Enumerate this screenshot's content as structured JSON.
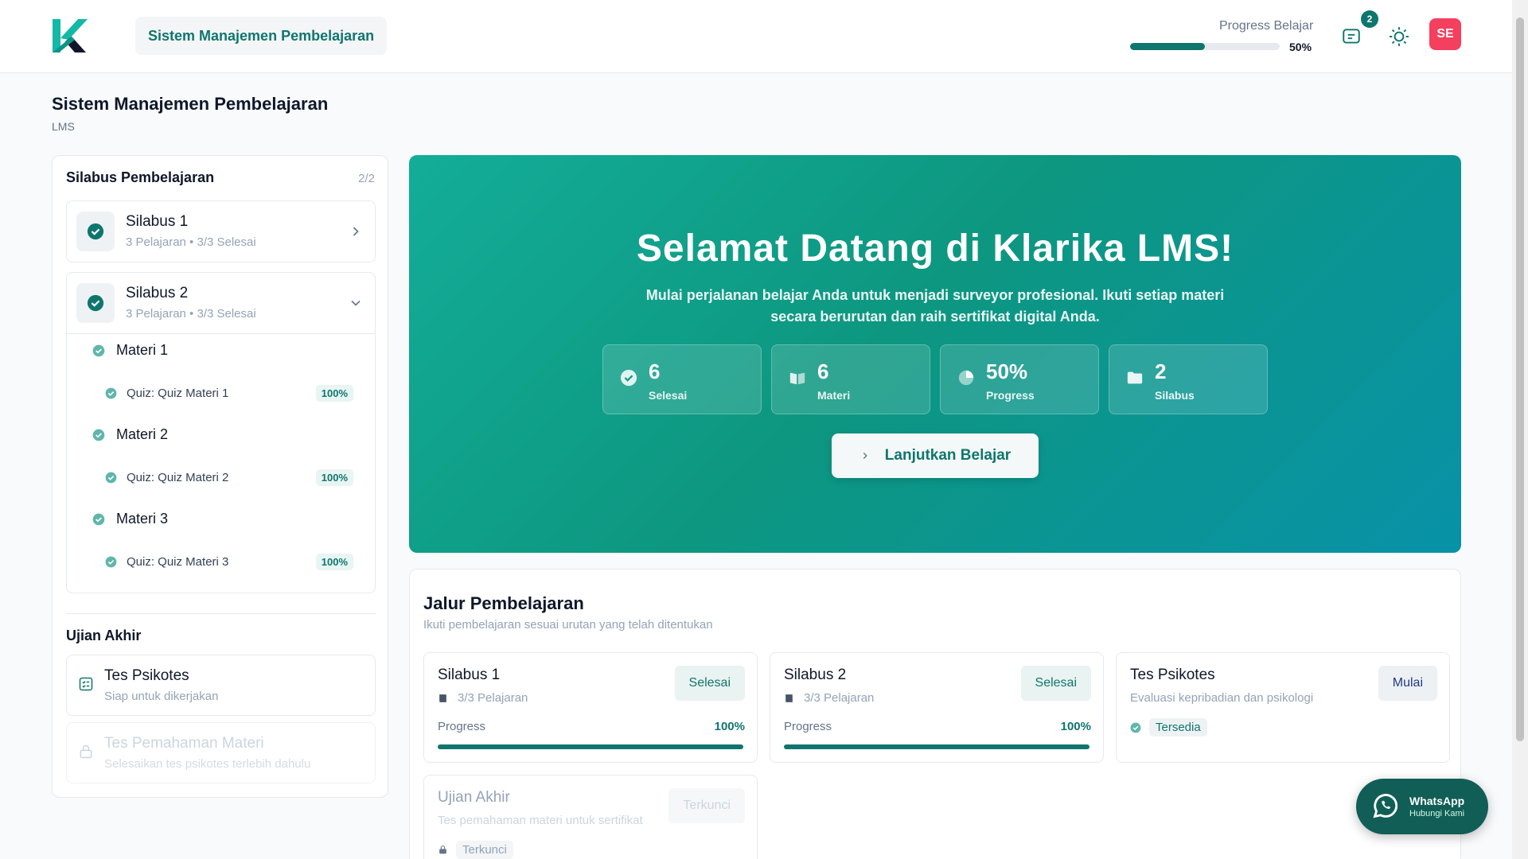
{
  "header": {
    "app_tab": "Sistem Manajemen Pembelajaran",
    "progress_label": "Progress Belajar",
    "progress_value": 50,
    "progress_text": "50%",
    "notif_count": "2",
    "avatar_initials": "SE"
  },
  "page": {
    "title": "Sistem Manajemen Pembelajaran",
    "subtitle": "LMS"
  },
  "sidebar": {
    "title": "Silabus Pembelajaran",
    "count": "2/2",
    "syllabi": [
      {
        "name": "Silabus 1",
        "meta": "3 Pelajaran • 3/3 Selesai"
      },
      {
        "name": "Silabus 2",
        "meta": "3 Pelajaran • 3/3 Selesai"
      }
    ],
    "materials": [
      {
        "name": "Materi 1",
        "quiz": "Quiz: Quiz Materi 1",
        "score": "100%"
      },
      {
        "name": "Materi 2",
        "quiz": "Quiz: Quiz Materi 2",
        "score": "100%"
      },
      {
        "name": "Materi 3",
        "quiz": "Quiz: Quiz Materi 3",
        "score": "100%"
      }
    ],
    "final_title": "Ujian Akhir",
    "exams": [
      {
        "name": "Tes Psikotes",
        "desc": "Siap untuk dikerjakan"
      },
      {
        "name": "Tes Pemahaman Materi",
        "desc": "Selesaikan tes psikotes terlebih dahulu"
      }
    ]
  },
  "hero": {
    "title": "Selamat Datang di Klarika LMS!",
    "subtitle": "Mulai perjalanan belajar Anda untuk menjadi surveyor profesional. Ikuti setiap materi secara berurutan dan raih sertifikat digital Anda.",
    "stats": [
      {
        "value": "6",
        "label": "Selesai",
        "icon": "check-circle-icon"
      },
      {
        "value": "6",
        "label": "Materi",
        "icon": "book-icon"
      },
      {
        "value": "50%",
        "label": "Progress",
        "icon": "pie-icon"
      },
      {
        "value": "2",
        "label": "Silabus",
        "icon": "folder-icon"
      }
    ],
    "cta": "Lanjutkan Belajar"
  },
  "path": {
    "title": "Jalur Pembelajaran",
    "subtitle": "Ikuti pembelajaran sesuai urutan yang telah ditentukan",
    "cards": [
      {
        "name": "Silabus 1",
        "meta": "3/3 Pelajaran",
        "button": "Selesai",
        "progress_label": "Progress",
        "progress_text": "100%",
        "progress": 100
      },
      {
        "name": "Silabus 2",
        "meta": "3/3 Pelajaran",
        "button": "Selesai",
        "progress_label": "Progress",
        "progress_text": "100%",
        "progress": 100
      },
      {
        "name": "Tes Psikotes",
        "meta": "Evaluasi kepribadian dan psikologi",
        "button": "Mulai",
        "tag": "Tersedia"
      },
      {
        "name": "Ujian Akhir",
        "meta": "Tes pemahaman materi untuk sertifikat",
        "button": "Terkunci",
        "tag": "Terkunci"
      }
    ]
  },
  "whatsapp": {
    "title": "WhatsApp",
    "subtitle": "Hubungi Kami"
  },
  "colors": {
    "primary": "#0f766e",
    "hero_start": "#13ad98",
    "hero_end": "#0892a8",
    "avatar": "#f43f5e",
    "whatsapp": "#115e57"
  }
}
